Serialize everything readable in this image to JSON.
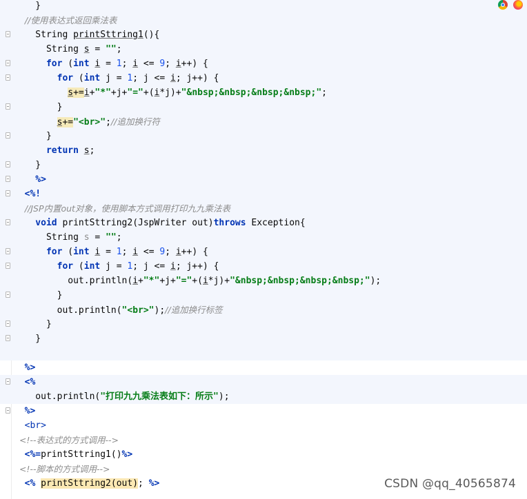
{
  "editor": {
    "lines": [
      {
        "html": [
          [
            "t",
            "    }"
          ]
        ]
      },
      {
        "html": [
          [
            "c",
            "    //使用表达式返回乘法表"
          ]
        ]
      },
      {
        "html": [
          [
            "t",
            "    String "
          ],
          [
            "t u",
            "printSttring1"
          ],
          [
            "t",
            "(){"
          ]
        ]
      },
      {
        "html": [
          [
            "t",
            "      String "
          ],
          [
            "t u",
            "s"
          ],
          [
            "t",
            " = "
          ],
          [
            "s",
            "\"\""
          ],
          [
            "t",
            ";"
          ]
        ]
      },
      {
        "html": [
          [
            "k",
            "      for"
          ],
          [
            "t",
            " ("
          ],
          [
            "k",
            "int"
          ],
          [
            "t",
            " "
          ],
          [
            "t u",
            "i"
          ],
          [
            "t",
            " = "
          ],
          [
            "n",
            "1"
          ],
          [
            "t",
            "; "
          ],
          [
            "t u",
            "i"
          ],
          [
            "t",
            " <= "
          ],
          [
            "n",
            "9"
          ],
          [
            "t",
            "; "
          ],
          [
            "t u",
            "i"
          ],
          [
            "t",
            "++) {"
          ]
        ]
      },
      {
        "html": [
          [
            "k",
            "        for"
          ],
          [
            "t",
            " ("
          ],
          [
            "k",
            "int"
          ],
          [
            "t",
            " j = "
          ],
          [
            "n",
            "1"
          ],
          [
            "t",
            "; j <= "
          ],
          [
            "t u",
            "i"
          ],
          [
            "t",
            "; j++) {"
          ]
        ]
      },
      {
        "html": [
          [
            "t",
            "          "
          ],
          [
            "t u hl",
            "s"
          ],
          [
            "t hl",
            "+="
          ],
          [
            "t u",
            "i"
          ],
          [
            "t",
            "+"
          ],
          [
            "s",
            "\"*\""
          ],
          [
            "t",
            "+j+"
          ],
          [
            "s",
            "\"=\""
          ],
          [
            "t",
            "+("
          ],
          [
            "t u",
            "i"
          ],
          [
            "t",
            "*j)+"
          ],
          [
            "s",
            "\"&nbsp;&nbsp;&nbsp;&nbsp;\""
          ],
          [
            "t",
            ";"
          ]
        ]
      },
      {
        "html": [
          [
            "t",
            "        }"
          ]
        ]
      },
      {
        "html": [
          [
            "t",
            "        "
          ],
          [
            "t u hl",
            "s"
          ],
          [
            "t hl",
            "+="
          ],
          [
            "s",
            "\"<br>\""
          ],
          [
            "t",
            ";"
          ],
          [
            "c",
            "//追加换行符"
          ]
        ]
      },
      {
        "html": [
          [
            "t",
            "      }"
          ]
        ]
      },
      {
        "html": [
          [
            "k",
            "      return"
          ],
          [
            "t",
            " "
          ],
          [
            "t u",
            "s"
          ],
          [
            "t",
            ";"
          ]
        ]
      },
      {
        "html": [
          [
            "t",
            "    }"
          ]
        ]
      },
      {
        "html": [
          [
            "jt",
            "    %>"
          ]
        ]
      },
      {
        "html": [
          [
            "jt",
            "  <%!"
          ]
        ]
      },
      {
        "html": [
          [
            "c",
            "    //JSP内置out对象，使用脚本方式调用打印九九乘法表"
          ]
        ]
      },
      {
        "html": [
          [
            "k",
            "    void"
          ],
          [
            "t",
            " printSttring2(JspWriter out)"
          ],
          [
            "k",
            "throws"
          ],
          [
            "t",
            " Exception{"
          ]
        ]
      },
      {
        "html": [
          [
            "t",
            "      String "
          ],
          [
            "gray",
            "s"
          ],
          [
            "t",
            " = "
          ],
          [
            "s",
            "\"\""
          ],
          [
            "t",
            ";"
          ]
        ]
      },
      {
        "html": [
          [
            "k",
            "      for"
          ],
          [
            "t",
            " ("
          ],
          [
            "k",
            "int"
          ],
          [
            "t",
            " "
          ],
          [
            "t u",
            "i"
          ],
          [
            "t",
            " = "
          ],
          [
            "n",
            "1"
          ],
          [
            "t",
            "; "
          ],
          [
            "t u",
            "i"
          ],
          [
            "t",
            " <= "
          ],
          [
            "n",
            "9"
          ],
          [
            "t",
            "; "
          ],
          [
            "t u",
            "i"
          ],
          [
            "t",
            "++) {"
          ]
        ]
      },
      {
        "html": [
          [
            "k",
            "        for"
          ],
          [
            "t",
            " ("
          ],
          [
            "k",
            "int"
          ],
          [
            "t",
            " j = "
          ],
          [
            "n",
            "1"
          ],
          [
            "t",
            "; j <= "
          ],
          [
            "t u",
            "i"
          ],
          [
            "t",
            "; j++) {"
          ]
        ]
      },
      {
        "html": [
          [
            "t",
            "          out.println("
          ],
          [
            "t u",
            "i"
          ],
          [
            "t",
            "+"
          ],
          [
            "s",
            "\"*\""
          ],
          [
            "t",
            "+j+"
          ],
          [
            "s",
            "\"=\""
          ],
          [
            "t",
            "+("
          ],
          [
            "t u",
            "i"
          ],
          [
            "t",
            "*j)+"
          ],
          [
            "s",
            "\"&nbsp;&nbsp;&nbsp;&nbsp;\""
          ],
          [
            "t",
            ");"
          ]
        ]
      },
      {
        "html": [
          [
            "t",
            "        }"
          ]
        ]
      },
      {
        "html": [
          [
            "t",
            "        out.println("
          ],
          [
            "s",
            "\"<br>\""
          ],
          [
            "t",
            ");"
          ],
          [
            "c",
            "//追加换行标签"
          ]
        ]
      },
      {
        "html": [
          [
            "t",
            "      }"
          ]
        ]
      },
      {
        "html": [
          [
            "t",
            "    }"
          ]
        ]
      },
      {
        "html": [
          [
            "t",
            ""
          ]
        ]
      },
      {
        "html": [
          [
            "jt",
            "  %>"
          ]
        ]
      },
      {
        "html": [
          [
            "jt",
            "  <%"
          ]
        ]
      },
      {
        "html": [
          [
            "t",
            "    out.println("
          ],
          [
            "s",
            "\"打印九九乘法表如下：所示\""
          ],
          [
            "t",
            ");"
          ]
        ]
      },
      {
        "html": [
          [
            "jt",
            "  %>"
          ]
        ]
      },
      {
        "html": [
          [
            "tag",
            "  <br>"
          ]
        ]
      },
      {
        "html": [
          [
            "c",
            "  <!--表达式的方式调用-->"
          ]
        ]
      },
      {
        "html": [
          [
            "jt",
            "  <%="
          ],
          [
            "t",
            "printSttring1()"
          ],
          [
            "jt",
            "%>"
          ]
        ]
      },
      {
        "html": [
          [
            "c",
            "  <!--脚本的方式调用-->"
          ]
        ]
      },
      {
        "html": [
          [
            "jt",
            "  <%"
          ],
          [
            "t",
            " "
          ],
          [
            "t hl2",
            "printSttring2(out)"
          ],
          [
            "t",
            "; "
          ],
          [
            "jt",
            "%>"
          ]
        ]
      }
    ]
  },
  "watermark": "CSDN @qq_40565874",
  "icons": [
    "chrome-icon",
    "firefox-icon"
  ]
}
